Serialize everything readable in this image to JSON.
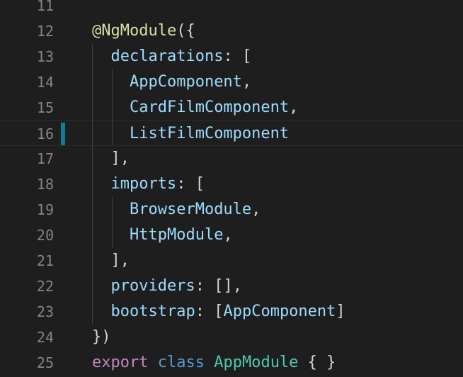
{
  "editor": {
    "current_line": "16",
    "lines": [
      {
        "num": "11",
        "tokens": []
      },
      {
        "num": "12",
        "tokens": [
          {
            "t": "@NgModule",
            "c": "#dcdcaa"
          },
          {
            "t": "({",
            "c": "#d4d4d4"
          }
        ]
      },
      {
        "num": "13",
        "tokens": [
          {
            "t": "  ",
            "c": "#d4d4d4"
          },
          {
            "t": "declarations",
            "c": "#9cdcfe"
          },
          {
            "t": ": [",
            "c": "#d4d4d4"
          }
        ]
      },
      {
        "num": "14",
        "tokens": [
          {
            "t": "    ",
            "c": "#d4d4d4"
          },
          {
            "t": "AppComponent",
            "c": "#9cdcfe"
          },
          {
            "t": ",",
            "c": "#d4d4d4"
          }
        ]
      },
      {
        "num": "15",
        "tokens": [
          {
            "t": "    ",
            "c": "#d4d4d4"
          },
          {
            "t": "CardFilmComponent",
            "c": "#9cdcfe"
          },
          {
            "t": ",",
            "c": "#d4d4d4"
          }
        ]
      },
      {
        "num": "16",
        "tokens": [
          {
            "t": "    ",
            "c": "#d4d4d4"
          },
          {
            "t": "ListFilmComponent",
            "c": "#9cdcfe"
          }
        ]
      },
      {
        "num": "17",
        "tokens": [
          {
            "t": "  ],",
            "c": "#d4d4d4"
          }
        ]
      },
      {
        "num": "18",
        "tokens": [
          {
            "t": "  ",
            "c": "#d4d4d4"
          },
          {
            "t": "imports",
            "c": "#9cdcfe"
          },
          {
            "t": ": [",
            "c": "#d4d4d4"
          }
        ]
      },
      {
        "num": "19",
        "tokens": [
          {
            "t": "    ",
            "c": "#d4d4d4"
          },
          {
            "t": "BrowserModule",
            "c": "#9cdcfe"
          },
          {
            "t": ",",
            "c": "#d4d4d4"
          }
        ]
      },
      {
        "num": "20",
        "tokens": [
          {
            "t": "    ",
            "c": "#d4d4d4"
          },
          {
            "t": "HttpModule",
            "c": "#9cdcfe"
          },
          {
            "t": ",",
            "c": "#d4d4d4"
          }
        ]
      },
      {
        "num": "21",
        "tokens": [
          {
            "t": "  ],",
            "c": "#d4d4d4"
          }
        ]
      },
      {
        "num": "22",
        "tokens": [
          {
            "t": "  ",
            "c": "#d4d4d4"
          },
          {
            "t": "providers",
            "c": "#9cdcfe"
          },
          {
            "t": ": [],",
            "c": "#d4d4d4"
          }
        ]
      },
      {
        "num": "23",
        "tokens": [
          {
            "t": "  ",
            "c": "#d4d4d4"
          },
          {
            "t": "bootstrap",
            "c": "#9cdcfe"
          },
          {
            "t": ": [",
            "c": "#d4d4d4"
          },
          {
            "t": "AppComponent",
            "c": "#9cdcfe"
          },
          {
            "t": "]",
            "c": "#d4d4d4"
          }
        ]
      },
      {
        "num": "24",
        "tokens": [
          {
            "t": "})",
            "c": "#d4d4d4"
          }
        ]
      },
      {
        "num": "25",
        "tokens": [
          {
            "t": "export",
            "c": "#c586c0"
          },
          {
            "t": " ",
            "c": "#d4d4d4"
          },
          {
            "t": "class",
            "c": "#569cd6"
          },
          {
            "t": " ",
            "c": "#d4d4d4"
          },
          {
            "t": "AppModule",
            "c": "#4ec9b0"
          },
          {
            "t": " { }",
            "c": "#d4d4d4"
          }
        ]
      }
    ]
  }
}
